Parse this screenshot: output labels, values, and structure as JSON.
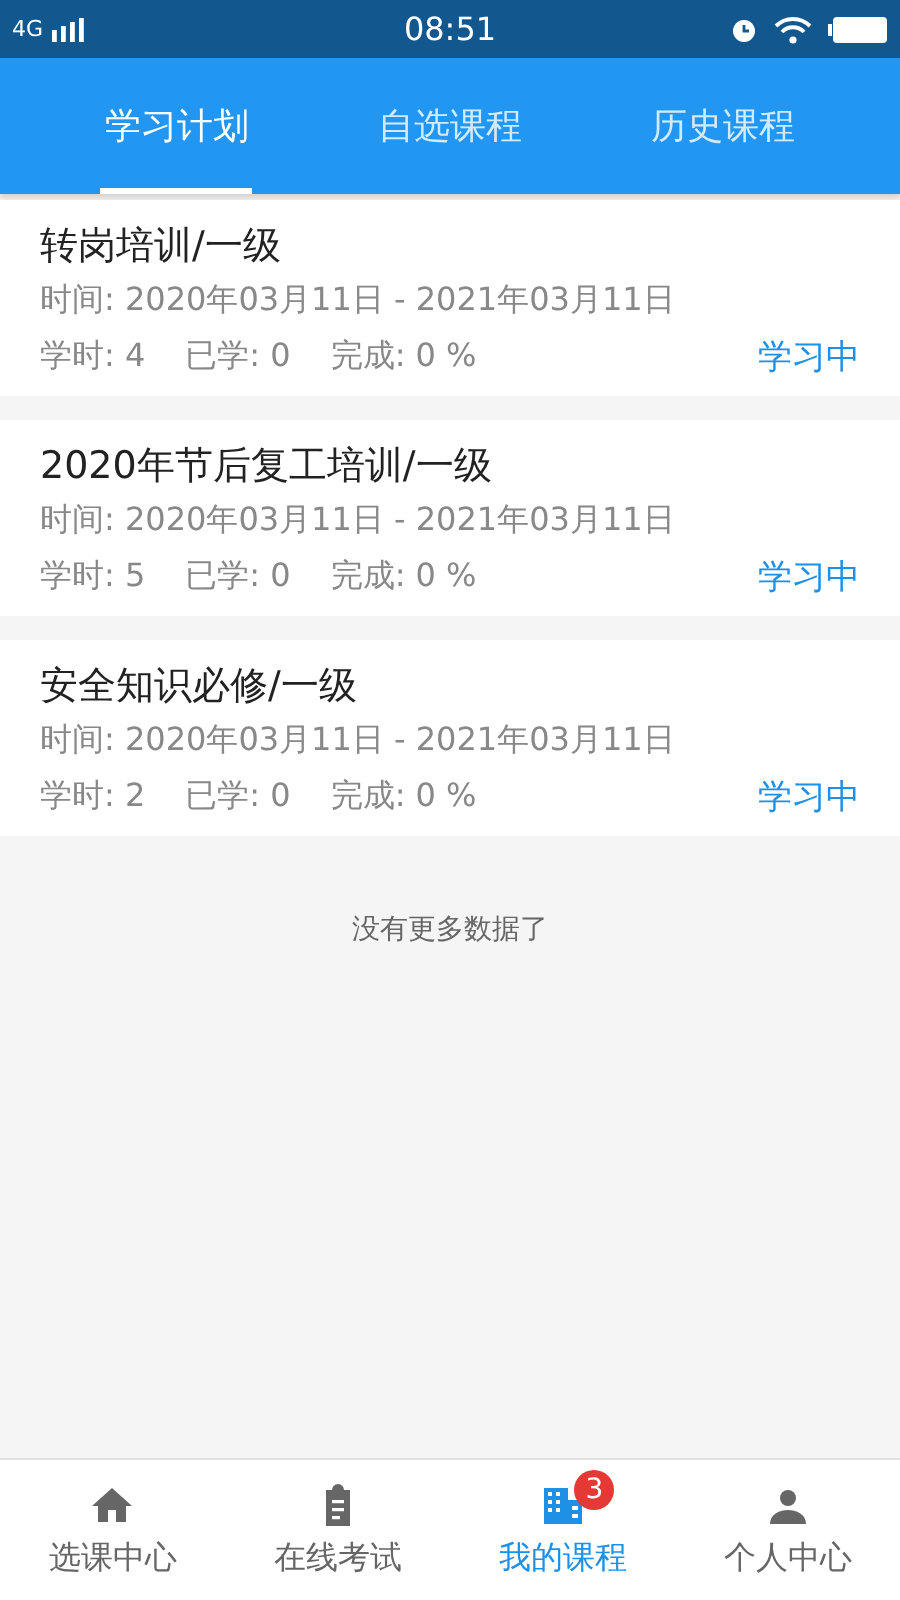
{
  "status_bar": {
    "network": "4G",
    "time": "08:51"
  },
  "tabs": [
    {
      "label": "学习计划",
      "selected": true
    },
    {
      "label": "自选课程",
      "selected": false
    },
    {
      "label": "历史课程",
      "selected": false
    }
  ],
  "courses": [
    {
      "title": "转岗培训/一级",
      "time": "时间: 2020年03月11日 - 2021年03月11日",
      "hours": "学时: 4",
      "learned": "已学: 0",
      "completion": "完成: 0 %",
      "status": "学习中"
    },
    {
      "title": "2020年节后复工培训/一级",
      "time": "时间: 2020年03月11日 - 2021年03月11日",
      "hours": "学时: 5",
      "learned": "已学: 0",
      "completion": "完成: 0 %",
      "status": "学习中"
    },
    {
      "title": "安全知识必修/一级",
      "time": "时间: 2020年03月11日 - 2021年03月11日",
      "hours": "学时: 2",
      "learned": "已学: 0",
      "completion": "完成: 0 %",
      "status": "学习中"
    }
  ],
  "footer_note": "没有更多数据了",
  "bottom_nav": [
    {
      "kind": "home",
      "label": "选课中心",
      "selected": false
    },
    {
      "kind": "clipboard",
      "label": "在线考试",
      "selected": false
    },
    {
      "kind": "building",
      "label": "我的课程",
      "selected": true,
      "badge": "3"
    },
    {
      "kind": "person",
      "label": "个人中心",
      "selected": false
    }
  ]
}
